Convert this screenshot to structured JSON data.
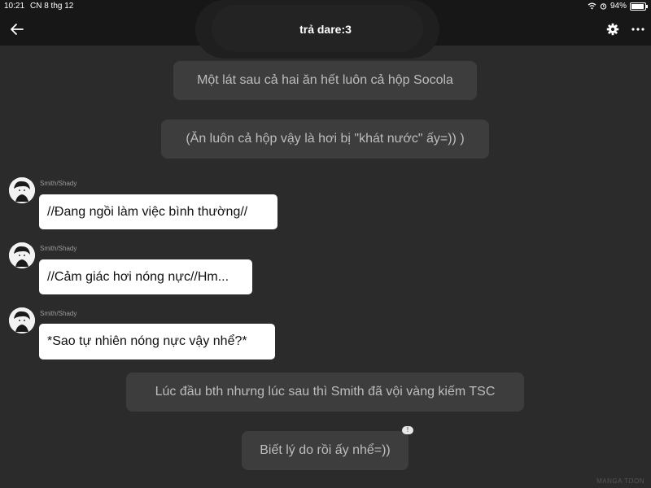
{
  "status_bar": {
    "time": "10:21",
    "date": "CN 8 thg 12",
    "battery": "94%",
    "battery_level": 0.94
  },
  "header": {
    "title": "trả dare:3",
    "back_icon": "arrow-left-icon",
    "settings_icon": "gear-icon",
    "more_icon": "more-dots-icon"
  },
  "messages": {
    "narration_1": "Một lát sau cả hai ăn hết luôn cả hộp Socola",
    "narration_2": "(Ăn luôn cả hộp vậy là hơi bị \"khát nước\" ấy=)) )",
    "chat_1": {
      "sender": "Smith/Shady",
      "text": "//Đang ngồi làm việc bình thường//"
    },
    "chat_2": {
      "sender": "Smith/Shady",
      "text": "//Cảm giác hơi nóng nực//Hm..."
    },
    "chat_3": {
      "sender": "Smith/Shady",
      "text": "*Sao tự nhiên nóng nực vậy nhể?*"
    },
    "narration_3": "Lúc đầu bth nhưng lúc sau thì Smith đã vội vàng kiếm TSC",
    "narration_4": "Biết lý do rồi ấy nhể=))",
    "narration_4_badge": "!"
  },
  "watermark": "MANGA TOON",
  "colors": {
    "background": "#2b2b2b",
    "bar": "#171717",
    "narration_bg": "#3d3d3d",
    "narration_text": "#bdbdbd",
    "bubble_bg": "#ffffff"
  }
}
